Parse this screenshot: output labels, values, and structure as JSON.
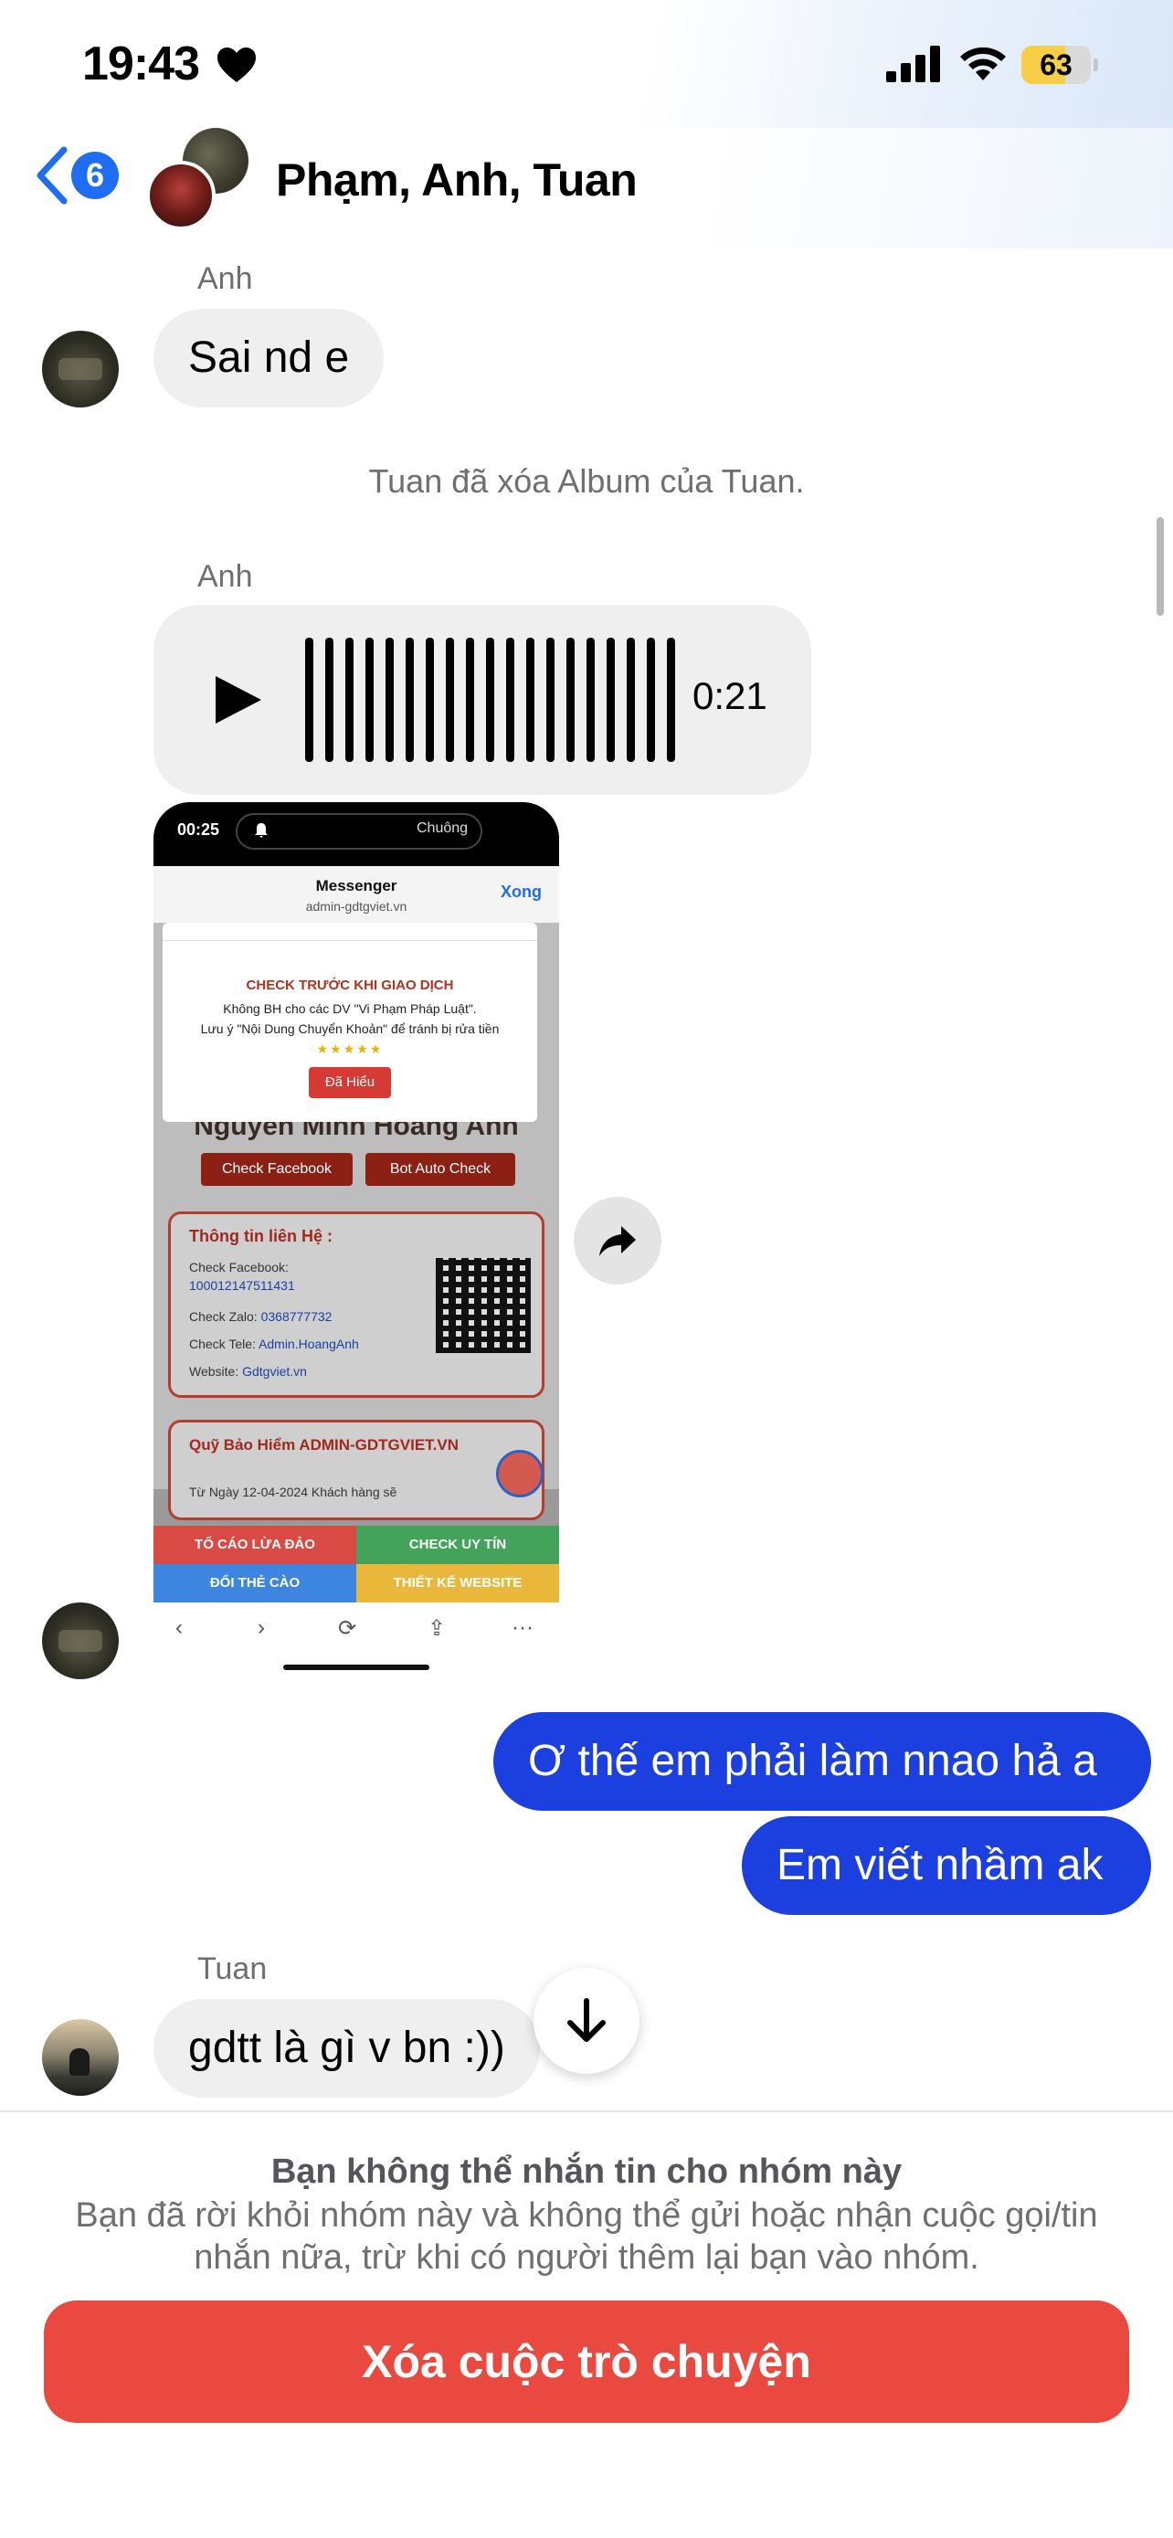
{
  "status_bar": {
    "time": "19:43",
    "battery": "63",
    "battery_level": 0.63,
    "icons": [
      "heart-icon",
      "signal-icon",
      "wifi-icon",
      "battery-icon"
    ]
  },
  "header": {
    "back_count": "6",
    "title": "Phạm, Anh, Tuan"
  },
  "messages": {
    "m1_sender": "Anh",
    "m1_text": "Sai nd e",
    "system_text": "Tuan đã xóa Album của Tuan.",
    "m2_sender": "Anh",
    "voice_duration": "0:21",
    "out1": "Ơ thế em phải làm nnao hả a",
    "out2": "Em viết nhầm ak",
    "m3_sender": "Tuan",
    "m3_text": "gdtt là gì v bn :))"
  },
  "screenshot": {
    "time": "00:25",
    "chuong": "Chuông",
    "app": "Messenger",
    "url": "admin-gdtgviet.vn",
    "done": "Xong",
    "modal_title": "CHECK TRƯỚC KHI GIAO DỊCH",
    "modal_line1": "Không BH cho các DV \"Vi Phạm Pháp Luật\".",
    "modal_line2": "Lưu ý \"Nội Dung Chuyển Khoản\" để tránh bị rửa tiền",
    "modal_stars": "★★★★★",
    "modal_button": "Đã Hiểu",
    "name": "Nguyen Minh Hoang Anh",
    "btn_facebook": "Check Facebook",
    "btn_bot": "Bot Auto Check",
    "contact_title": "Thông tin liên Hệ :",
    "contact_fb_label": "Check Facebook:",
    "contact_fb_value": "100012147511431",
    "contact_zalo_label": "Check Zalo:",
    "contact_zalo_value": "0368777732",
    "contact_tele_label": "Check Tele:",
    "contact_tele_value": "Admin.HoangAnh",
    "contact_web_label": "Website:",
    "contact_web_value": "Gdtgviet.vn",
    "fund_title": "Quỹ Bảo Hiểm ADMIN-GDTGVIET.VN",
    "fund_sub": "Từ Ngày 12-04-2024 Khách hàng sẽ",
    "tab1": "TỐ CÁO LỪA ĐẢO",
    "tab2": "CHECK UY TÍN",
    "tab3": "ĐỔI THẺ CÀO",
    "tab4": "THIẾT KẾ WEBSITE"
  },
  "footer": {
    "title": "Bạn không thể nhắn tin cho nhóm này",
    "desc": "Bạn đã rời khỏi nhóm này và không thể gửi hoặc nhận cuộc gọi/tin nhắn nữa, trừ khi có người thêm lại bạn vào nhóm.",
    "delete_label": "Xóa cuộc trò chuyện"
  },
  "colors": {
    "accent_blue": "#1f6df0",
    "outgoing_bubble": "#1c3fe0",
    "incoming_bubble": "#efefef",
    "delete_red": "#e9493f",
    "battery_yellow": "#f7ce46"
  }
}
